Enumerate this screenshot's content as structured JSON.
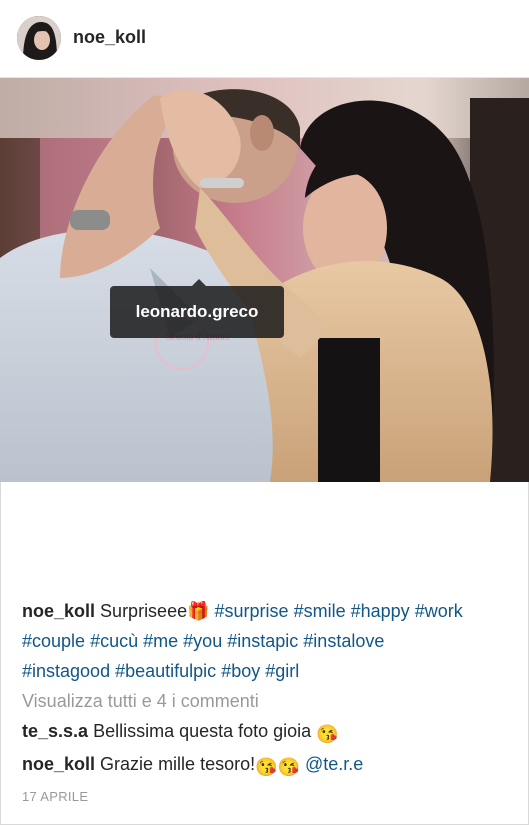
{
  "header": {
    "username": "noe_koll"
  },
  "photo": {
    "tag_label": "leonardo.greco",
    "watermark_text": "Scuola d'Amore"
  },
  "caption": {
    "username": "noe_koll",
    "text": "Surpriseee🎁",
    "hashtags_line1": [
      "#surprise",
      "#smile",
      "#happy",
      "#work"
    ],
    "hashtags_line2": [
      "#couple",
      "#cucù",
      "#me",
      "#you",
      "#instapic",
      "#instalove"
    ],
    "hashtags_line3": [
      "#instagood",
      "#beautifulpic",
      "#boy",
      "#girl"
    ]
  },
  "view_all_comments": "Visualizza tutti e 4 i commenti",
  "comments": [
    {
      "username": "te_s.s.a",
      "text": "Bellissima questa foto gioia",
      "emoji": "😘"
    },
    {
      "username": "noe_koll",
      "text": "Grazie mille tesoro!",
      "emoji": "😘😘",
      "mention": "@te.r.e"
    }
  ],
  "date": "17 APRILE",
  "colors": {
    "link": "#125688",
    "muted": "#999999",
    "text": "#262626"
  },
  "icons": {
    "tag_user_badge": "person-icon"
  }
}
